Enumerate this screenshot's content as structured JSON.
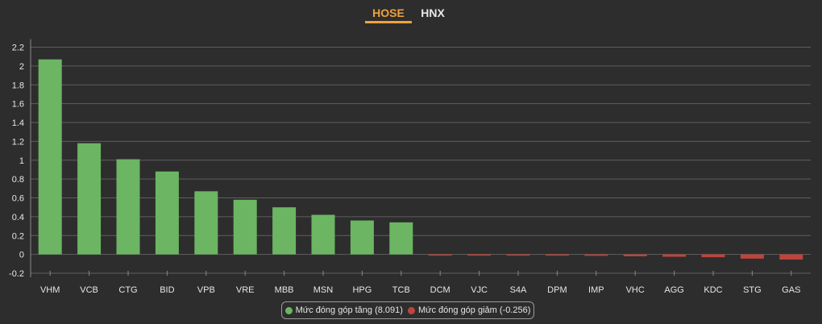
{
  "tabs": [
    {
      "label": "HOSE",
      "active": true
    },
    {
      "label": "HNX",
      "active": false
    }
  ],
  "colors": {
    "accent": "#f0a23b",
    "positive": "#6bb563",
    "negative": "#c0443c",
    "grid": "#5e5e5e",
    "axis_text": "#e6e6e6"
  },
  "legend": {
    "positive_label": "Mức đóng góp tăng (8.091)",
    "negative_label": "Mức đóng góp giảm (-0.256)"
  },
  "chart_data": {
    "type": "bar",
    "title": "",
    "xlabel": "",
    "ylabel": "",
    "ylim": [
      -0.2,
      2.2
    ],
    "yticks": [
      "-0.2",
      "0",
      "0.2",
      "0.4",
      "0.6",
      "0.8",
      "1",
      "1.2",
      "1.4",
      "1.6",
      "1.8",
      "2",
      "2.2"
    ],
    "grid": true,
    "legend_position": "bottom",
    "categories": [
      "VHM",
      "VCB",
      "CTG",
      "BID",
      "VPB",
      "VRE",
      "MBB",
      "MSN",
      "HPG",
      "TCB",
      "DCM",
      "VJC",
      "S4A",
      "DPM",
      "IMP",
      "VHC",
      "AGG",
      "KDC",
      "STG",
      "GAS"
    ],
    "values": [
      2.07,
      1.18,
      1.01,
      0.88,
      0.67,
      0.58,
      0.5,
      0.42,
      0.36,
      0.34,
      -0.01,
      -0.01,
      -0.01,
      -0.01,
      -0.015,
      -0.02,
      -0.025,
      -0.03,
      -0.045,
      -0.055
    ]
  }
}
